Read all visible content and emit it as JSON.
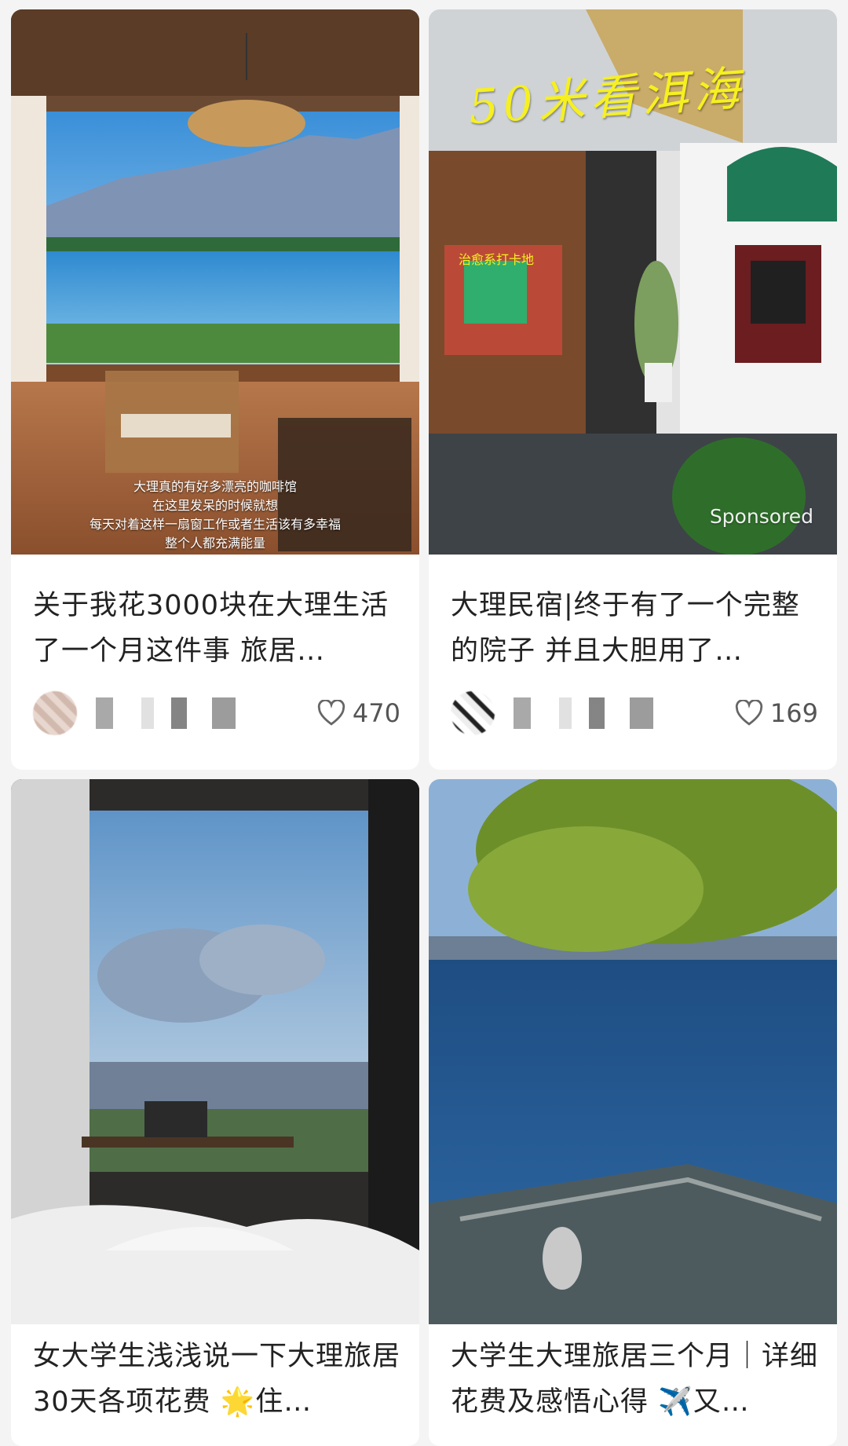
{
  "feed": {
    "cards": [
      {
        "title": "关于我花3000块在大理生活了一个月这件事 旅居…",
        "likes": "470",
        "image_caption": [
          "大理真的有好多漂亮的咖啡馆",
          "在这里发呆的时候就想",
          "每天对着这样一扇窗工作或者生活该有多幸福",
          "整个人都充满能量"
        ]
      },
      {
        "title": "大理民宿|终于有了一个完整的院子 并且大胆用了…",
        "likes": "169",
        "image_headline": "50米看洱海",
        "image_tag": "治愈系打卡地",
        "sponsored": "Sponsored"
      },
      {
        "title": "女大学生浅浅说一下大理旅居30天各项花费 🌟住…"
      },
      {
        "title": "大学生大理旅居三个月｜详细花费及感悟心得 ✈️又…"
      }
    ]
  }
}
